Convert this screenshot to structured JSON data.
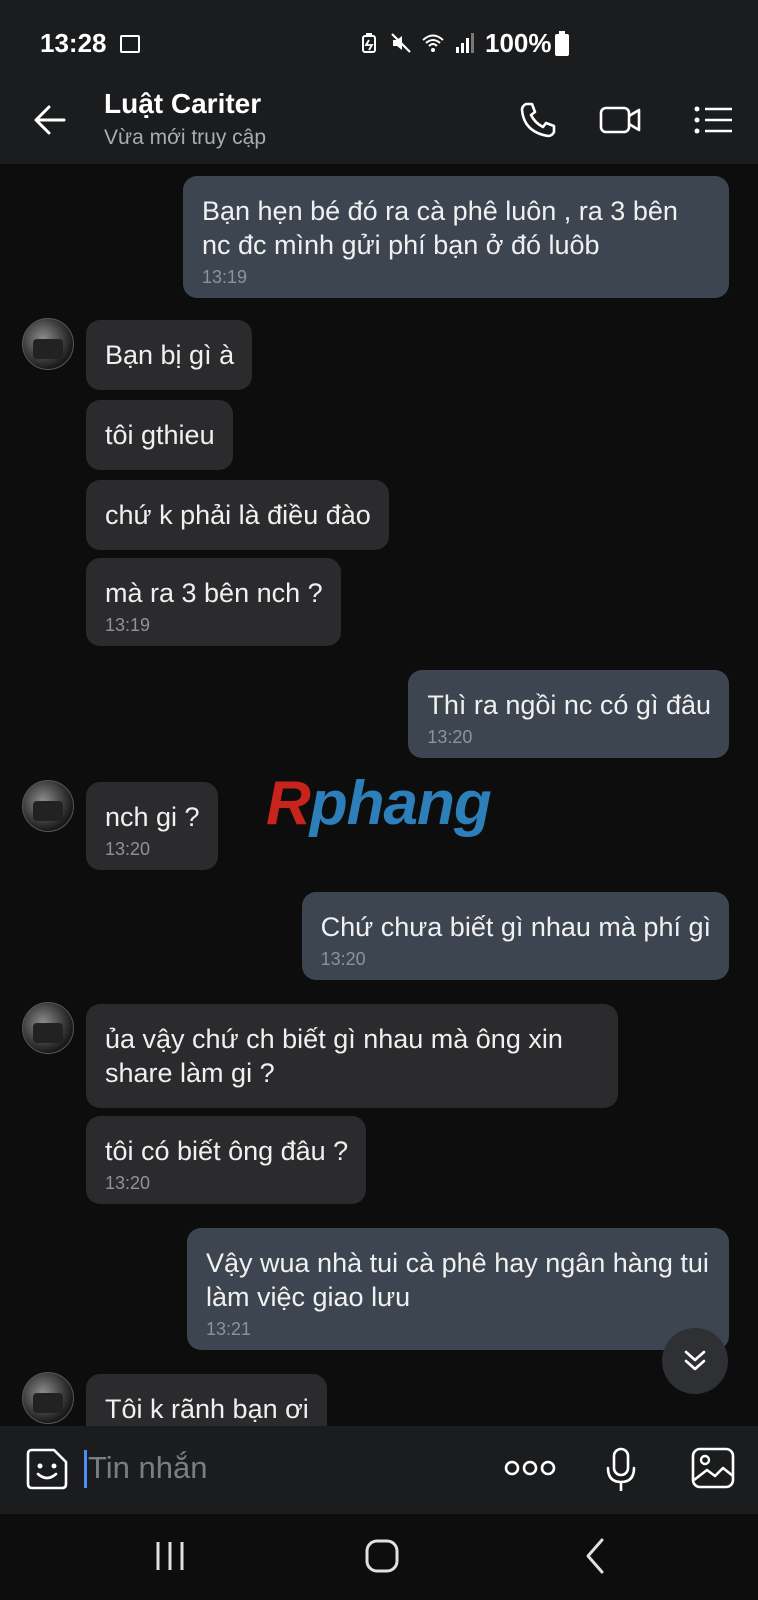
{
  "status_bar": {
    "time": "13:28",
    "battery": "100%"
  },
  "header": {
    "contact_name": "Luật Cariter",
    "contact_status": "Vừa mới truy cập"
  },
  "messages": [
    {
      "dir": "out",
      "text": "Bạn hẹn bé đó ra cà phê luôn , ra 3 bên nc đc mình gửi phí bạn ở đó luôb",
      "time": "13:19"
    },
    {
      "dir": "in",
      "text": "Bạn bị gì à"
    },
    {
      "dir": "in",
      "text": "tôi gthieu"
    },
    {
      "dir": "in",
      "text": "chứ k phải là điều đào"
    },
    {
      "dir": "in",
      "text": "mà ra 3 bên nch ?",
      "time": "13:19"
    },
    {
      "dir": "out",
      "text": "Thì ra ngồi nc có gì đâu",
      "time": "13:20"
    },
    {
      "dir": "in",
      "text": "nch gi ?",
      "time": "13:20"
    },
    {
      "dir": "out",
      "text": "Chứ chưa biết gì nhau mà phí gì",
      "time": "13:20"
    },
    {
      "dir": "in",
      "text": "ủa vậy chứ ch biết gì nhau mà ông xin share làm gi ?"
    },
    {
      "dir": "in",
      "text": "tôi có biết ông đâu ?",
      "time": "13:20"
    },
    {
      "dir": "out",
      "text": "Vậy wua nhà tui cà phê hay ngân hàng tui làm việc giao lưu",
      "time": "13:21"
    },
    {
      "dir": "in",
      "text": "Tôi k rãnh bạn ơi"
    }
  ],
  "watermark": {
    "first": "R",
    "rest": "phang"
  },
  "composer": {
    "placeholder": "Tin nhắn"
  },
  "colors": {
    "incoming_bubble": "#2b2b2d",
    "outgoing_bubble": "#3d4551",
    "background": "#0d0d0e",
    "caret": "#4f8cf4",
    "watermark_red": "#c8241d",
    "watermark_blue": "#2c7fb8"
  },
  "icons": [
    "image-icon",
    "battery-saver-icon",
    "mute-icon",
    "wifi-icon",
    "signal-icon",
    "back-arrow-icon",
    "phone-icon",
    "video-call-icon",
    "menu-list-icon",
    "scroll-down-icon",
    "sticker-icon",
    "more-icon",
    "mic-icon",
    "gallery-icon",
    "recent-apps-icon",
    "home-icon",
    "nav-back-icon"
  ]
}
